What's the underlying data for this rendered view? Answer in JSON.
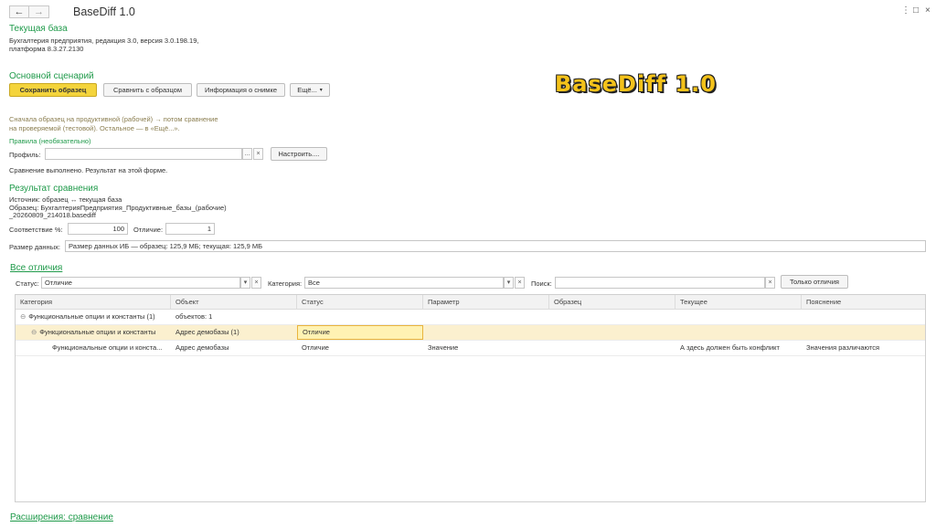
{
  "window": {
    "title": "BaseDiff 1.0",
    "back_glyph": "←",
    "forward_glyph": "→",
    "menu_glyph": "⋮",
    "maximize_glyph": "□",
    "close_glyph": "×"
  },
  "current_db": {
    "title": "Текущая база",
    "line1": "Бухгалтерия предприятия, редакция 3.0, версия 3.0.198.19,",
    "line2": "платформа 8.3.27.2130"
  },
  "scenario": {
    "title": "Основной сценарий",
    "save_label": "Сохранить образец",
    "compare_label": "Сравнить с образцом",
    "info_label": "Информация о снимке",
    "more_label": "Ещё...",
    "hint1": "Сначала образец на продуктивной (рабочей) → потом сравнение",
    "hint2": "на проверяемой (тестовой). Остальное — в «Ещё...».",
    "rules_title": "Правила (необязательно)",
    "profile_label": "Профиль:",
    "profile_value": "",
    "configure_label": "Настроить....",
    "status_message": "Сравнение выполнено. Результат на этой форме."
  },
  "logo": {
    "text": "BaseDiff 1.0"
  },
  "result": {
    "title": "Результат сравнения",
    "source_line1": "Источник: образец ↔ текущая база",
    "source_line2": "Образец: БухгалтерияПредприятия_Продуктивные_базы_(рабочие)",
    "source_line3": "_20260809_214018.basediff",
    "match_label": "Соответствие %:",
    "match_value": "100",
    "diff_label": "Отличие:",
    "diff_value": "1",
    "size_label": "Размер данных:",
    "size_value": "Размер данных ИБ — образец: 125,9 МБ; текущая: 125,9 МБ"
  },
  "diffs": {
    "title": "Все отличия",
    "status_label": "Статус:",
    "status_value": "Отличие",
    "category_label": "Категория:",
    "category_value": "Все",
    "search_label": "Поиск:",
    "search_value": "",
    "only_diffs_label": "Только отличия",
    "columns": [
      "Категория",
      "Объект",
      "Статус",
      "Параметр",
      "Образец",
      "Текущее",
      "Пояснение"
    ],
    "rows": [
      [
        "Функциональные опции и константы (1)",
        "объектов: 1",
        "",
        "",
        "",
        "",
        ""
      ],
      [
        "Функциональные опции и константы",
        "Адрес демобазы (1)",
        "Отличие",
        "",
        "",
        "",
        ""
      ],
      [
        "Функциональные опции и конста...",
        "Адрес демобазы",
        "Отличие",
        "Значение",
        "",
        "А здесь должен быть конфликт",
        "Значения различаются"
      ]
    ]
  },
  "extensions": {
    "title": "Расширения: сравнение"
  }
}
